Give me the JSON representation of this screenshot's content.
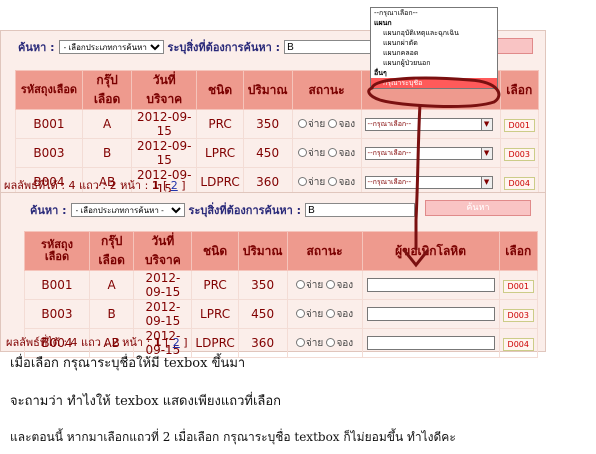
{
  "search": {
    "label": "ค้นหา :",
    "type_placeholder": "- เลือกประเภทการค้นหา -",
    "specify_label": "ระบุสิ่งที่ต้องการค้นหา :",
    "query": "B",
    "button": "ค้นหา"
  },
  "table": {
    "headers": [
      "รหัสถุงเลือด",
      "กรุ๊ปเลือด",
      "วันที่บริจาค",
      "ชนิด",
      "ปริมาณ",
      "สถานะ",
      "",
      "เลือก"
    ],
    "header_bottom_6": "ผู้ขอเบิกโลหิต",
    "rows": [
      {
        "id": "B001",
        "group": "A",
        "date": "2012-09-15",
        "type": "PRC",
        "amount": "350",
        "pay": "จ่าย",
        "reserve": "จอง",
        "choose": "D001"
      },
      {
        "id": "B003",
        "group": "B",
        "date": "2012-09-15",
        "type": "LPRC",
        "amount": "450",
        "pay": "จ่าย",
        "reserve": "จอง",
        "choose": "D003"
      },
      {
        "id": "B004",
        "group": "AB",
        "date": "2012-09-15",
        "type": "LDPRC",
        "amount": "360",
        "pay": "จ่าย",
        "reserve": "จอง",
        "choose": "D004"
      }
    ],
    "select_default": "--กรุณาเลือก--"
  },
  "pager": {
    "prefix": "ผลลัพธ์ที่ได้ : 4 แถว : 2 หน้า :",
    "current": "1",
    "open": "[",
    "page2": "2",
    "close": "]"
  },
  "dropdown": {
    "items": [
      {
        "text": "--กรุณาเลือก--",
        "kind": "top"
      },
      {
        "text": "แผนก",
        "kind": "grp"
      },
      {
        "text": "แผนกอุบัติเหตุและฉุกเฉิน",
        "kind": "opt"
      },
      {
        "text": "แผนกผ่าตัด",
        "kind": "opt"
      },
      {
        "text": "แผนกคลอด",
        "kind": "opt"
      },
      {
        "text": "แผนกผู้ป่วยนอก",
        "kind": "opt"
      },
      {
        "text": "อื่นๆ",
        "kind": "grp"
      },
      {
        "text": "กรุณาระบุชื่อ",
        "kind": "hl"
      }
    ]
  },
  "captions": {
    "line1": "เมื่อเลือก กรุณาระบุชื่อให้มี texbox ขึ้นมา",
    "line2": "จะถามว่า ทำไงให้ texbox แสดงเพียงแถวที่เลือก",
    "line3": "และตอนนี้ หากมาเลือกแถวที่ 2 เมื่อเลือก กรุณาระบุชื่อ textbox ก็ไม่ยอมขึ้น ทำไงดีคะ"
  },
  "colors": {
    "header_bg": "#ee9a8e",
    "panel_bg": "#fbeeea",
    "annotation": "#7a1010"
  }
}
